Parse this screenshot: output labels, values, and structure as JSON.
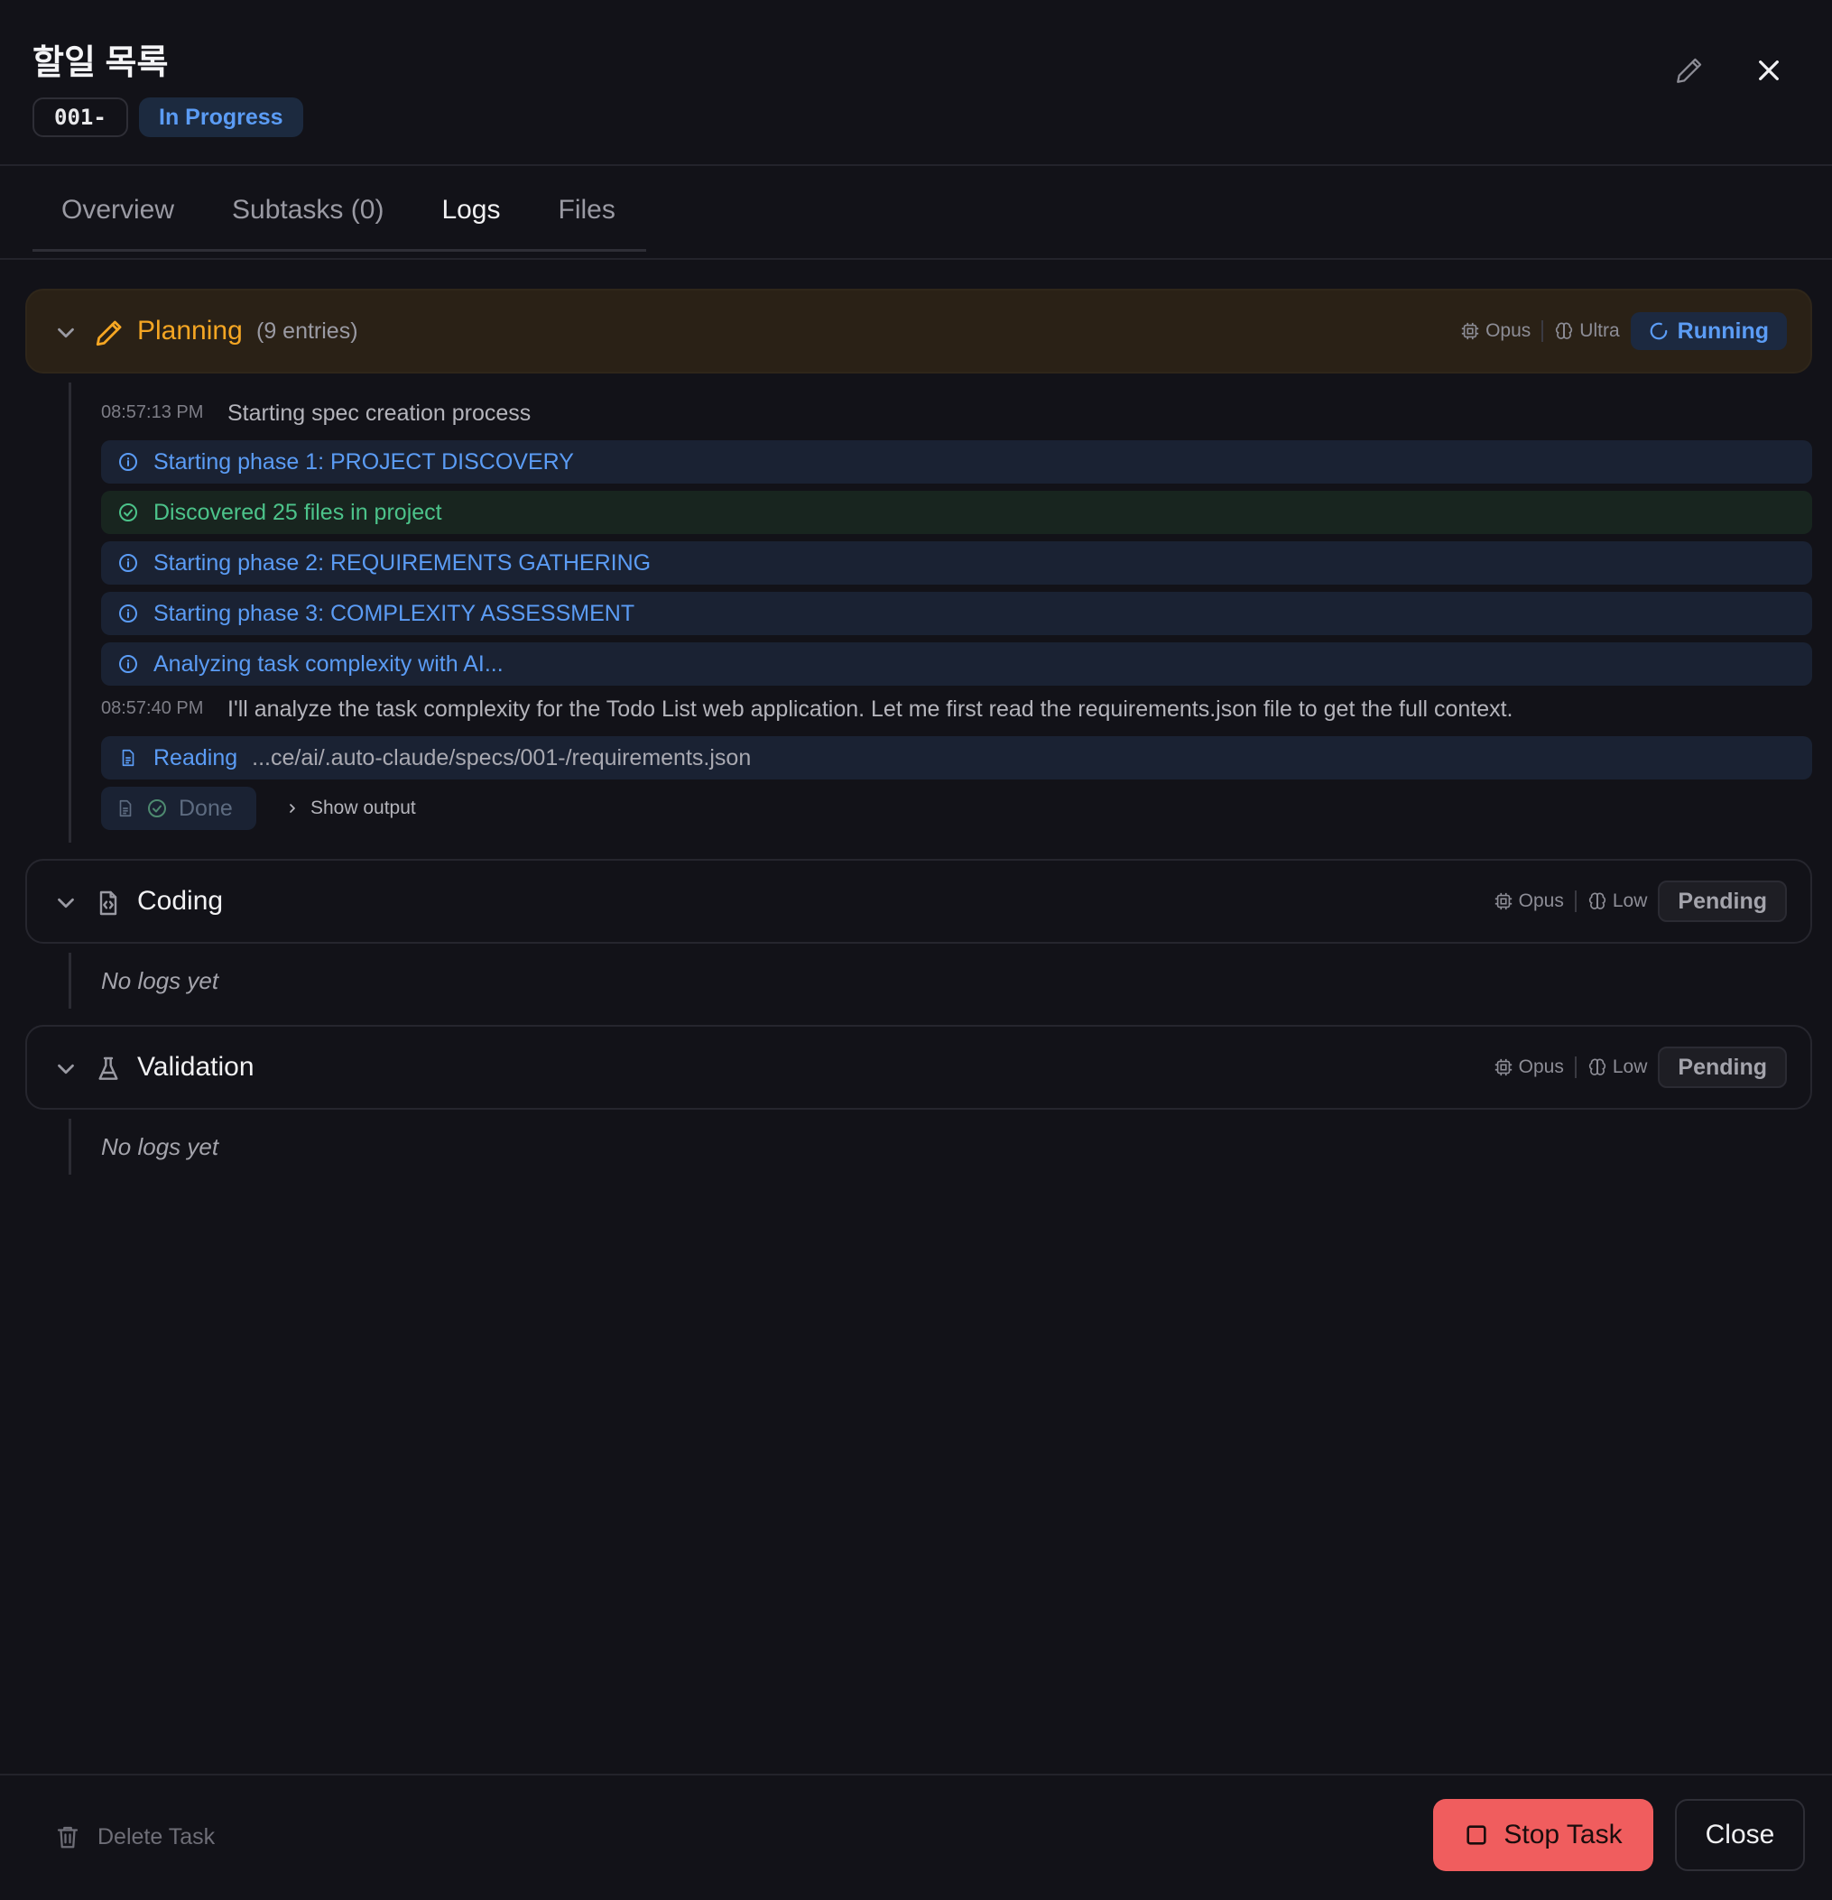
{
  "header": {
    "title": "할일 목록",
    "task_id": "001-",
    "status": "In Progress"
  },
  "tabs": [
    {
      "label": "Overview"
    },
    {
      "label": "Subtasks (0)"
    },
    {
      "label": "Logs"
    },
    {
      "label": "Files"
    }
  ],
  "active_tab": "Logs",
  "phases": {
    "planning": {
      "name": "Planning",
      "count": "(9 entries)",
      "model": "Opus",
      "thinking": "Ultra",
      "status": "Running",
      "logs": {
        "t1": "08:57:13 PM",
        "m1": "Starting spec creation process",
        "e1": "Starting phase 1: PROJECT DISCOVERY",
        "e2": "Discovered 25 files in project",
        "e3": "Starting phase 2: REQUIREMENTS GATHERING",
        "e4": "Starting phase 3: COMPLEXITY ASSESSMENT",
        "e5": "Analyzing task complexity with AI...",
        "t2": "08:57:40 PM",
        "m2": "I'll analyze the task complexity for the Todo List web application. Let me first read the requirements.json file to get the full context.",
        "tool_label": "Reading",
        "tool_path": "...ce/ai/.auto-claude/specs/001-/requirements.json",
        "done_label": "Done",
        "show_output": "Show output"
      }
    },
    "coding": {
      "name": "Coding",
      "model": "Opus",
      "thinking": "Low",
      "status": "Pending",
      "empty": "No logs yet"
    },
    "validation": {
      "name": "Validation",
      "model": "Opus",
      "thinking": "Low",
      "status": "Pending",
      "empty": "No logs yet"
    }
  },
  "footer": {
    "delete": "Delete Task",
    "stop": "Stop Task",
    "close": "Close"
  },
  "colors": {
    "accent_blue": "#5b9cf5",
    "planning_orange": "#f5a623",
    "success_green": "#4cc38a",
    "stop_red": "#f05d5e"
  }
}
